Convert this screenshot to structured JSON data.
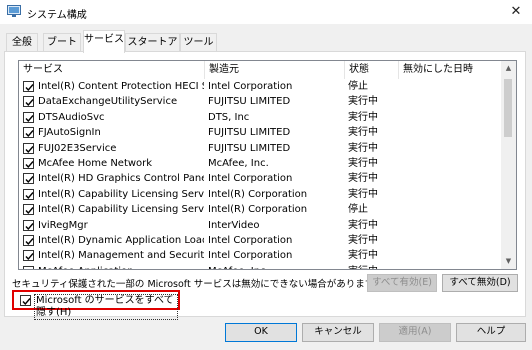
{
  "window": {
    "title": "システム構成",
    "close_glyph": "✕"
  },
  "tabs": [
    {
      "label": "全般"
    },
    {
      "label": "ブート"
    },
    {
      "label": "サービス"
    },
    {
      "label": "スタートアップ"
    },
    {
      "label": "ツール"
    }
  ],
  "active_tab": "サービス",
  "columns": {
    "service": "サービス",
    "manufacturer": "製造元",
    "status": "状態",
    "disabled_date": "無効にした日時"
  },
  "rows": [
    {
      "service": "Intel(R) Content Protection HECI Ser...",
      "manufacturer": "Intel Corporation",
      "status": "停止",
      "checked": true
    },
    {
      "service": "DataExchangeUtilityService",
      "manufacturer": "FUJITSU LIMITED",
      "status": "実行中",
      "checked": true
    },
    {
      "service": "DTSAudioSvc",
      "manufacturer": "DTS, Inc",
      "status": "実行中",
      "checked": true
    },
    {
      "service": "FJAutoSignIn",
      "manufacturer": "FUJITSU LIMITED",
      "status": "実行中",
      "checked": true
    },
    {
      "service": "FUJ02E3Service",
      "manufacturer": "FUJITSU LIMITED",
      "status": "実行中",
      "checked": true
    },
    {
      "service": "McAfee Home Network",
      "manufacturer": "McAfee, Inc.",
      "status": "実行中",
      "checked": true
    },
    {
      "service": "Intel(R) HD Graphics Control Panel S...",
      "manufacturer": "Intel Corporation",
      "status": "実行中",
      "checked": true
    },
    {
      "service": "Intel(R) Capability Licensing Service I...",
      "manufacturer": "Intel(R) Corporation",
      "status": "実行中",
      "checked": true
    },
    {
      "service": "Intel(R) Capability Licensing Service ...",
      "manufacturer": "Intel(R) Corporation",
      "status": "停止",
      "checked": true
    },
    {
      "service": "IviRegMgr",
      "manufacturer": "InterVideo",
      "status": "実行中",
      "checked": true
    },
    {
      "service": "Intel(R) Dynamic Application Loader ...",
      "manufacturer": "Intel Corporation",
      "status": "実行中",
      "checked": true
    },
    {
      "service": "Intel(R) Management and Security A...",
      "manufacturer": "Intel Corporation",
      "status": "実行中",
      "checked": true
    },
    {
      "service": "McAfee Application...",
      "manufacturer": "McAfee, Inc.",
      "status": "実行中",
      "checked": true
    }
  ],
  "note": "セキュリティ保護された一部の Microsoft サービスは無効にできない場合があります。",
  "buttons": {
    "enable_all": "すべて有効(E)",
    "disable_all": "すべて無効(D)",
    "ok": "OK",
    "cancel": "キャンセル",
    "apply": "適用(A)",
    "help": "ヘルプ"
  },
  "hide_ms": {
    "label": "Microsoft のサービスをすべて隠す(H)",
    "checked": true
  },
  "scrollbar": {
    "up_glyph": "▲",
    "down_glyph": "▼"
  }
}
